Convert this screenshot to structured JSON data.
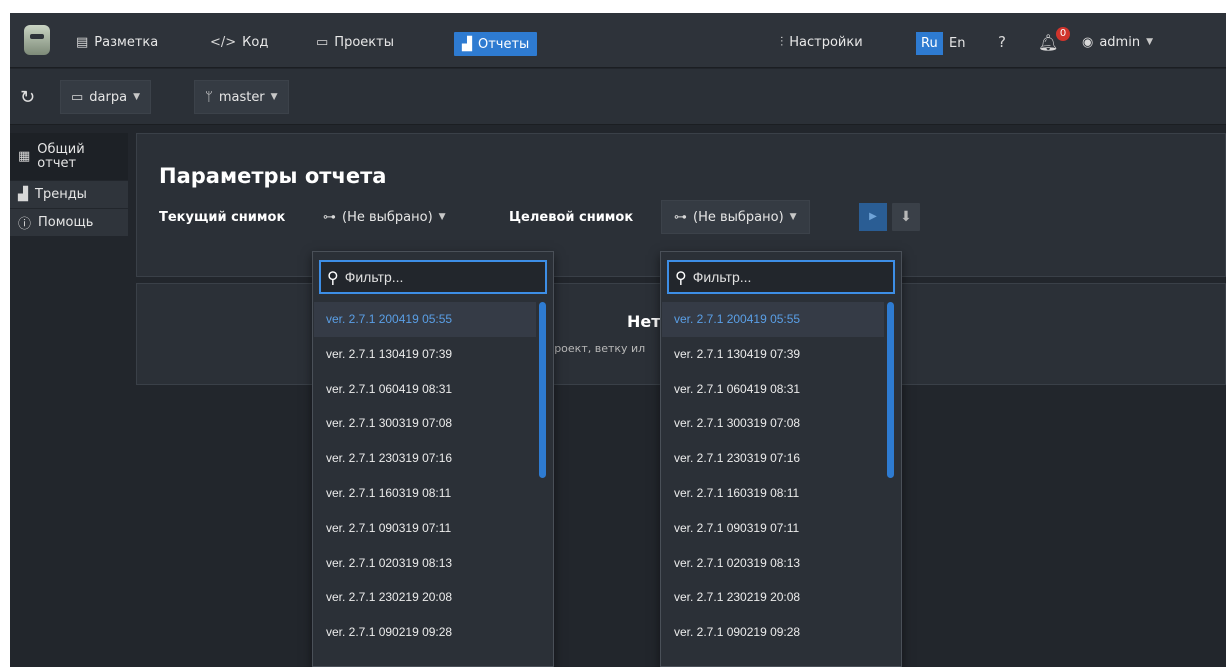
{
  "caption": "",
  "nav": {
    "markup": "Разметка",
    "code": "Код",
    "projects": "Проекты",
    "reports": "Отчеты",
    "settings": "Настройки",
    "lang_ru": "Ru",
    "lang_en": "En",
    "notifications_count": "0",
    "user": "admin"
  },
  "toolbar": {
    "project": "darpa",
    "branch": "master"
  },
  "sidebar": {
    "items": [
      {
        "label": "Общий отчет",
        "line1": "Общий",
        "line2": "отчет",
        "icon": "table-icon",
        "active": true
      },
      {
        "label": "Тренды",
        "icon": "chart-icon",
        "active": false
      },
      {
        "label": "Помощь",
        "icon": "info-icon",
        "active": false
      }
    ]
  },
  "report": {
    "title": "Параметры отчета",
    "current_snapshot_label": "Текущий снимок",
    "target_snapshot_label": "Целевой снимок",
    "current_value": "(Не выбрано)",
    "target_value": "(Не выбрано)"
  },
  "empty": {
    "title": "Нет",
    "hint": "проект, ветку ил"
  },
  "dropdown": {
    "placeholder": "Фильтр...",
    "options": [
      "ver. 2.7.1 200419 05:55",
      "ver. 2.7.1 130419 07:39",
      "ver. 2.7.1 060419 08:31",
      "ver. 2.7.1 300319 07:08",
      "ver. 2.7.1 230319 07:16",
      "ver. 2.7.1 160319 08:11",
      "ver. 2.7.1 090319 07:11",
      "ver. 2.7.1 020319 08:13",
      "ver. 2.7.1 230219 20:08",
      "ver. 2.7.1 090219 09:28"
    ],
    "selected_index": 0
  },
  "colors": {
    "accent": "#2e7bd1",
    "background": "#22262c",
    "panel": "#2b3037",
    "selected_text": "#5a9fe6"
  }
}
